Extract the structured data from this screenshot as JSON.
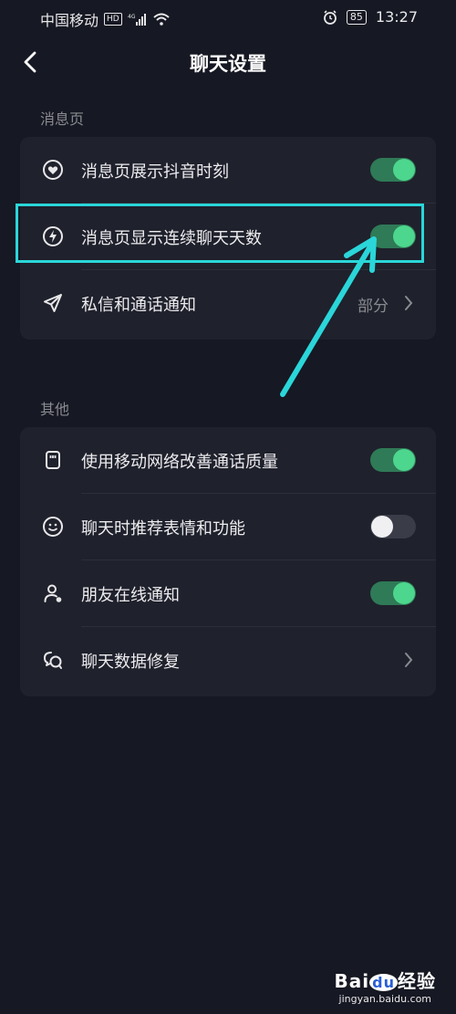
{
  "status_bar": {
    "carrier": "中国移动",
    "hd_badge": "HD",
    "signal_label": "4G",
    "battery": "85",
    "time": "13:27"
  },
  "header": {
    "title": "聊天设置"
  },
  "sections": [
    {
      "label": "消息页",
      "items": [
        {
          "label": "消息页展示抖音时刻",
          "icon": "heart-circle-icon",
          "control": "toggle",
          "on": true
        },
        {
          "label": "消息页显示连续聊天天数",
          "icon": "flame-circle-icon",
          "control": "toggle",
          "on": true
        },
        {
          "label": "私信和通话通知",
          "icon": "send-icon",
          "control": "link",
          "value": "部分"
        }
      ]
    },
    {
      "label": "其他",
      "items": [
        {
          "label": "使用移动网络改善通话质量",
          "icon": "sim-card-icon",
          "control": "toggle",
          "on": true
        },
        {
          "label": "聊天时推荐表情和功能",
          "icon": "smiley-icon",
          "control": "toggle",
          "on": false
        },
        {
          "label": "朋友在线通知",
          "icon": "person-online-icon",
          "control": "toggle",
          "on": true
        },
        {
          "label": "聊天数据修复",
          "icon": "chat-repair-icon",
          "control": "link"
        }
      ]
    }
  ],
  "annotation": {
    "color": "#2ad6d9",
    "target": "消息页显示连续聊天天数"
  },
  "watermark": {
    "brand": "Bai",
    "brand_mark": "du",
    "suffix": "经验",
    "url": "jingyan.baidu.com"
  },
  "colors": {
    "background": "#161823",
    "card": "#1f212c",
    "toggle_on_knob": "#4dd68d",
    "toggle_on_track": "#2f7a57",
    "annotation": "#2ad6d9"
  }
}
